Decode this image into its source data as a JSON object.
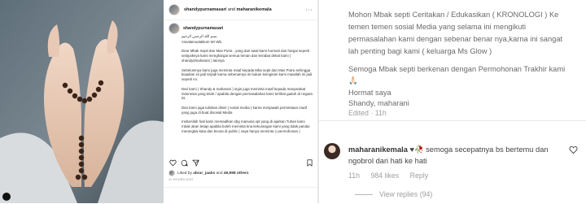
{
  "post": {
    "username": "shandypurnamasari",
    "conjunction": "and",
    "collaborator": "maharanikemala",
    "more": "···",
    "caption": {
      "username": "shandypurnamasari",
      "paragraphs": [
        "بسم الله الرحمن الرحيم",
        "Assalamualaikum Wr Wb.",
        "Dear Mbak Septi dan Mas Putra , yang dari awal kami hormati dan hargai seperti selayaknya kami menghargai semua teman dan kerabat dekat kami ( shandydmaharani ) lainnya",
        "Sebelumnya kami juga meminta maaf kepada Mba septi dan Mas Putra sehingga kejadian ini jadi terjadi karna sebenarnya ini bukan keinginan kami masalah ini jadi seperti ini.",
        "Dari kami ( Shandy & maharani ) ingin juga meminta maaf kepada masyarakat indonesia yang telah / apabila dengan permasalahan kami terlihat gaduh di negara ini.",
        "Dan kami juga tuliskan disini ( sosial media ) karna menjawab permintaan maaf yang juga di buat disosial Media",
        "InshaAllah hati kami memaafkan sbg manusia spt yang di ajarkan Tuhan kami mbak akan tetapi apabila boleh meminta kna kekurangan kami yang tidak pandai merangkai kata dan bicara di public ( saya hanya meminta 1 permohonan )"
      ]
    },
    "liked_by": {
      "prefix": "Liked by",
      "user": "abrar_jaabs",
      "middle": "and",
      "count": "49,998 others"
    },
    "time_ago": "11 HOURS AGO",
    "icons": [
      "heart-icon",
      "comment-icon",
      "share-icon",
      "bookmark-icon"
    ]
  },
  "right": {
    "caption_lines": [
      "Mohon Mbak septi Ceritakan / Edukasikan ( KRONOLOGI ) Ke",
      "temen temen sosial Media yang selama ini mengikuti",
      "permasalahan kami dengan sebenar benar nya,karna ini sangat",
      "lah penting bagi kami ( keluarga Ms Glow )",
      "",
      "Semoga Mbak septi berkenan dengan Permohonan Trakhir kami",
      "🙏🏻",
      "",
      "Hormat saya",
      "Shandy, maharani"
    ],
    "edited": "Edited · 11h",
    "comment": {
      "username": "maharanikemala",
      "text": "♥🥀 semoga secepatnya bs bertemu dan",
      "text2": "ngobrol dari hati ke hati",
      "time": "11h",
      "likes": "984 likes",
      "reply": "Reply",
      "view_replies": "View replies (94)"
    }
  }
}
